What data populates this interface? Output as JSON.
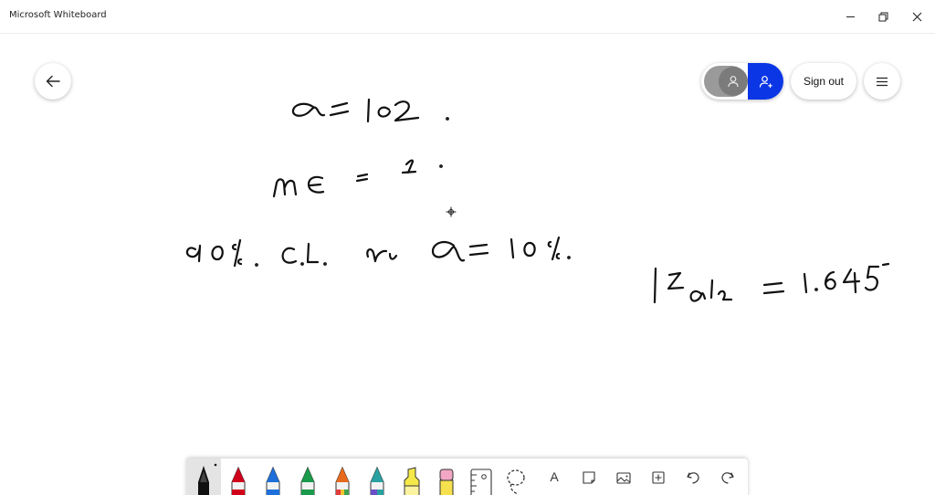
{
  "window": {
    "title": "Microsoft Whiteboard",
    "controls": {
      "minimize_icon": "minimize-icon",
      "maximize_icon": "restore-icon",
      "close_icon": "close-icon"
    }
  },
  "header": {
    "back_icon": "arrow-left-icon",
    "account_toggle": {
      "inactive_icon": "person-icon",
      "active_icon": "person-add-icon",
      "active_color": "#0a36e6"
    },
    "sign_out_label": "Sign out",
    "menu_icon": "hamburger-icon"
  },
  "toolbar": {
    "tools": [
      {
        "name": "ballpoint-pen",
        "color": "#111111",
        "active": true
      },
      {
        "name": "red-pen",
        "color": "#d0021b"
      },
      {
        "name": "blue-pen",
        "color": "#1e6fd9"
      },
      {
        "name": "green-pen",
        "color": "#1a9a4a"
      },
      {
        "name": "rainbow-pen",
        "color": "#e86a1c"
      },
      {
        "name": "galaxy-pen",
        "color": "#2aa1a0"
      },
      {
        "name": "highlighter",
        "color": "#f5e94a"
      },
      {
        "name": "eraser",
        "color": "#f2a7c3"
      },
      {
        "name": "ruler",
        "icon": "ruler-icon"
      },
      {
        "name": "lasso",
        "icon": "lasso-icon"
      },
      {
        "name": "text",
        "label": "A"
      },
      {
        "name": "sticky-note",
        "icon": "note-icon"
      },
      {
        "name": "image",
        "icon": "image-icon"
      },
      {
        "name": "insert",
        "icon": "plus-icon"
      },
      {
        "name": "undo",
        "icon": "undo-icon"
      },
      {
        "name": "redo",
        "icon": "redo-icon"
      }
    ]
  }
}
